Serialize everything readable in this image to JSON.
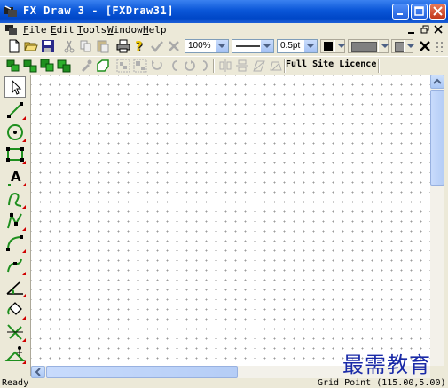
{
  "window": {
    "title": "FX Draw 3 - [FXDraw31]"
  },
  "menu": {
    "file": {
      "hot": "F",
      "rest": "ile"
    },
    "edit": {
      "hot": "E",
      "rest": "dit"
    },
    "tools": {
      "hot": "T",
      "rest": "ools"
    },
    "window": {
      "hot": "W",
      "rest": "indow"
    },
    "help": {
      "hot": "H",
      "rest": "elp"
    }
  },
  "toolbar": {
    "zoom": "100%",
    "line_width": "0.5pt",
    "licence": "Full Site Licence"
  },
  "left_tools": [
    "pointer",
    "line",
    "circle",
    "rectangle",
    "text",
    "freehand",
    "polyline",
    "curve",
    "path",
    "angle",
    "fill",
    "grid-tool",
    "figure"
  ],
  "status": {
    "left": "Ready",
    "right": "Grid Point (115.00,5.00)"
  },
  "watermark": "最需教育",
  "colors": {
    "title_bar": "#0a56d8",
    "accent_green": "#1e8f1e",
    "tool_marker": "#d00000"
  }
}
